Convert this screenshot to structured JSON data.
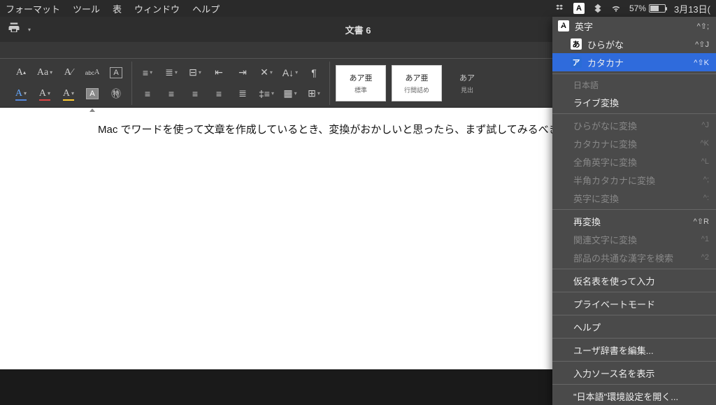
{
  "menubar": {
    "items": [
      "フォーマット",
      "ツール",
      "表",
      "ウィンドウ",
      "ヘルプ"
    ]
  },
  "status": {
    "input_badge": "A",
    "battery_pct": "57%",
    "date": "3月13日("
  },
  "titlebar": {
    "title": "文書 6"
  },
  "styles": [
    {
      "sample": "あア亜",
      "name": "標準"
    },
    {
      "sample": "あア亜",
      "name": "行間詰め"
    },
    {
      "sample": "あア",
      "name": "見出"
    }
  ],
  "document": {
    "text": "Mac でワードを使って文章を作成しているとき、変換がおかしいと思ったら、まず試してみるべきことは、",
    "cursor": "↩"
  },
  "ime": {
    "sources": [
      {
        "checked": true,
        "badge": "A",
        "badgeClass": "white",
        "label": "英字",
        "shortcut": "^⇧;"
      },
      {
        "checked": false,
        "badge": "あ",
        "badgeClass": "white",
        "label": "ひらがな",
        "shortcut": "^⇧J"
      },
      {
        "checked": false,
        "badge": "ア",
        "badgeClass": "blue",
        "label": "カタカナ",
        "shortcut": "^⇧K",
        "highlight": true
      }
    ],
    "heading1": "日本語",
    "live_convert": "ライブ変換",
    "conversions": [
      {
        "label": "ひらがなに変換",
        "shortcut": "^J"
      },
      {
        "label": "カタカナに変換",
        "shortcut": "^K"
      },
      {
        "label": "全角英字に変換",
        "shortcut": "^L"
      },
      {
        "label": "半角カタカナに変換",
        "shortcut": "^;"
      },
      {
        "label": "英字に変換",
        "shortcut": "^:"
      }
    ],
    "reconvert": {
      "label": "再変換",
      "shortcut": "^⇧R"
    },
    "related": [
      {
        "label": "関連文字に変換",
        "shortcut": "^1"
      },
      {
        "label": "部品の共通な漢字を検索",
        "shortcut": "^2"
      }
    ],
    "kana_table": "仮名表を使って入力",
    "private_mode": "プライベートモード",
    "help": "ヘルプ",
    "edit_dict": "ユーザ辞書を編集...",
    "show_source": "入力ソース名を表示",
    "open_prefs": "\"日本語\"環境設定を開く..."
  }
}
